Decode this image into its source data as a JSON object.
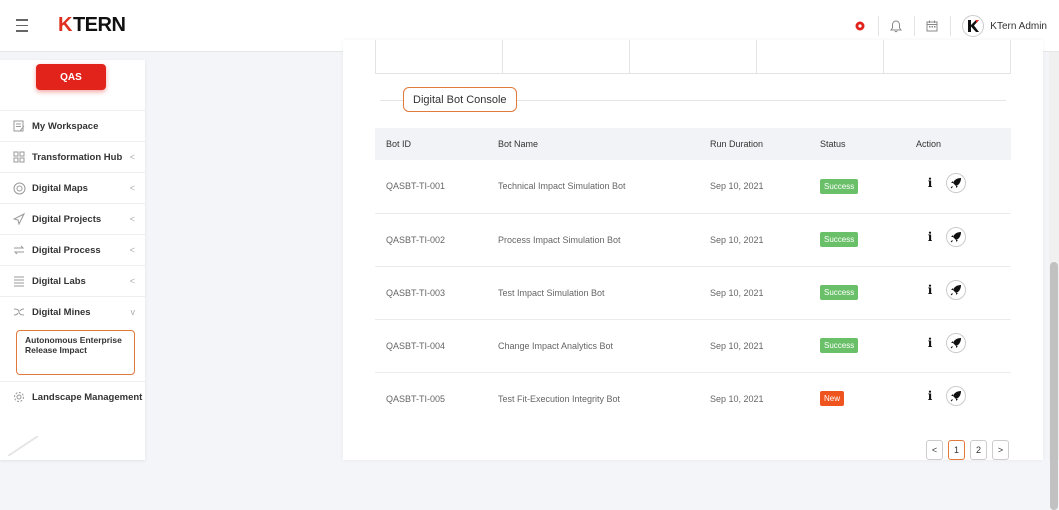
{
  "header": {
    "logo_k": "K",
    "logo_rest": "TERN",
    "user_name": "KTern Admin",
    "accent_red": "#e1231c",
    "icons": [
      "menu-icon",
      "alert-dot-icon",
      "bell-icon",
      "calendar-icon",
      "avatar-logo"
    ]
  },
  "sidebar": {
    "env_label": "QAS",
    "items": [
      {
        "label": "My Workspace",
        "icon": "workspace-icon",
        "chevron": ""
      },
      {
        "label": "Transformation Hub",
        "icon": "grid-icon",
        "chevron": "<"
      },
      {
        "label": "Digital Maps",
        "icon": "map-icon",
        "chevron": "<"
      },
      {
        "label": "Digital Projects",
        "icon": "send-icon",
        "chevron": "<"
      },
      {
        "label": "Digital Process",
        "icon": "process-icon",
        "chevron": "<"
      },
      {
        "label": "Digital Labs",
        "icon": "list-icon",
        "chevron": "<"
      },
      {
        "label": "Digital Mines",
        "icon": "mines-icon",
        "chevron": "v"
      }
    ],
    "sub_item": "Autonomous Enterprise Release Impact",
    "last_item": {
      "label": "Landscape Management",
      "icon": "gear-icon"
    }
  },
  "main": {
    "section_title": "Digital Bot Console",
    "columns": [
      "Bot ID",
      "Bot Name",
      "Run Duration",
      "Status",
      "Action"
    ],
    "rows": [
      {
        "id": "QASBT-TI-001",
        "name": "Technical Impact Simulation Bot",
        "date": "Sep 10, 2021",
        "status": "Success",
        "status_color": "#6abf69"
      },
      {
        "id": "QASBT-TI-002",
        "name": "Process Impact Simulation Bot",
        "date": "Sep 10, 2021",
        "status": "Success",
        "status_color": "#6abf69"
      },
      {
        "id": "QASBT-TI-003",
        "name": "Test Impact Simulation Bot",
        "date": "Sep 10, 2021",
        "status": "Success",
        "status_color": "#6abf69"
      },
      {
        "id": "QASBT-TI-004",
        "name": "Change Impact Analytics Bot",
        "date": "Sep 10, 2021",
        "status": "Success",
        "status_color": "#6abf69"
      },
      {
        "id": "QASBT-TI-005",
        "name": "Test Fit-Execution Integrity Bot",
        "date": "Sep 10, 2021",
        "status": "New",
        "status_color": "#f0541e"
      }
    ],
    "action_info": "i",
    "pagination": {
      "prev": "<",
      "pages": [
        "1",
        "2"
      ],
      "next": ">",
      "current": "1"
    }
  }
}
